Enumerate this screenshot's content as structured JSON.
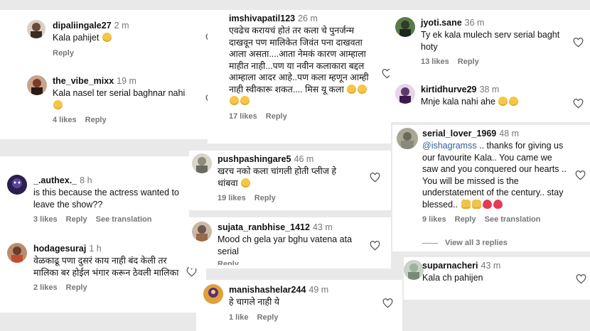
{
  "comments": {
    "c1": {
      "username": "dipaliingale27",
      "time": "2 m",
      "text": "Kala pahijet",
      "reply": "Reply",
      "avatar_color": "#6b4a3c"
    },
    "c2": {
      "username": "the_vibe_mixx",
      "time": "19 m",
      "text": "Kala nasel ter serial baghnar nahi",
      "likes": "4 likes",
      "reply": "Reply",
      "avatar_color": "#7a3d2b"
    },
    "c3": {
      "username": "_.authex._",
      "time": "8 h",
      "text": "is this because the actress wanted to leave the show??",
      "likes": "3 likes",
      "reply": "Reply",
      "see_translation": "See translation",
      "avatar_color": "#3b2a6b"
    },
    "c4": {
      "username": "hodagesuraj",
      "time": "1 h",
      "text": "वेळकाढू पणा दुसरं काय नाही बंद केली तर मालिका बर होईल भंगार करून ठेवली मालिका",
      "likes": "2 likes",
      "reply": "Reply",
      "avatar_color": "#a46a4b"
    },
    "c5": {
      "username": "imshivapatil123",
      "time": "26 m",
      "text": "एवढेच करायचं होतं तर कला चे पुनर्जन्म दाखवून पण मालिकेत जिवंत पना दाखवता आला असता....आता नेमकं कारण आम्हाला माहीत नाही...पण या नवीन कलाकारा बद्दल आम्हाला आदर आहे..पण कला म्हणून आम्ही नाही स्वीकारू शकत.... मिस यू कला",
      "likes": "17 likes",
      "reply": "Reply"
    },
    "c6": {
      "username": "pushpashingare5",
      "time": "46 m",
      "text": "खरच नको कला चांगली होती प्लीज हे थांबवा",
      "likes": "19 likes",
      "reply": "Reply",
      "avatar_color": "#8e8a7c"
    },
    "c7": {
      "username": "sujata_ranbhise_1412",
      "time": "43 m",
      "text": "Mood ch gela yar bghu vatena ata serial",
      "cut_label": "Reply",
      "avatar_color": "#6c5a4c"
    },
    "c8": {
      "username": "manishashelar244",
      "time": "49 m",
      "text": "हे चागले नाही ये",
      "likes": "1 like",
      "reply": "Reply",
      "avatar_color": "#5b2f7a"
    },
    "c9": {
      "username": "jyoti.sane",
      "time": "36 m",
      "text": "Ty ek kala mulech serv serial baght hoty",
      "likes": "13 likes",
      "reply": "Reply",
      "avatar_color": "#2e3b2a"
    },
    "c10": {
      "username": "kirtidhurve29",
      "time": "38 m",
      "text": "Mnje kala nahi ahe",
      "avatar_color": "#5c3a6c"
    },
    "c11": {
      "username": "serial_lover_1969",
      "time": "48 m",
      "mention": "@ishagramss",
      "text": ".. thanks for giving us our favourite Kala.. You came we saw and you conquered our hearts .. You will be missed is the understatement of the century.. stay blessed..",
      "likes": "9 likes",
      "reply": "Reply",
      "see_translation": "See translation",
      "view_all": "View all 3 replies",
      "avatar_color": "#8a8a7a"
    },
    "c12": {
      "username": "suparnacheri",
      "time": "43 m",
      "text": "Kala ch pahijen",
      "avatar_color": "#a0b0a0"
    }
  },
  "colors": {
    "username": "#111111",
    "meta": "#777777",
    "mention": "#2f5d9a",
    "heart_stroke": "#555555"
  },
  "icons": {
    "like": "heart-outline-icon"
  }
}
